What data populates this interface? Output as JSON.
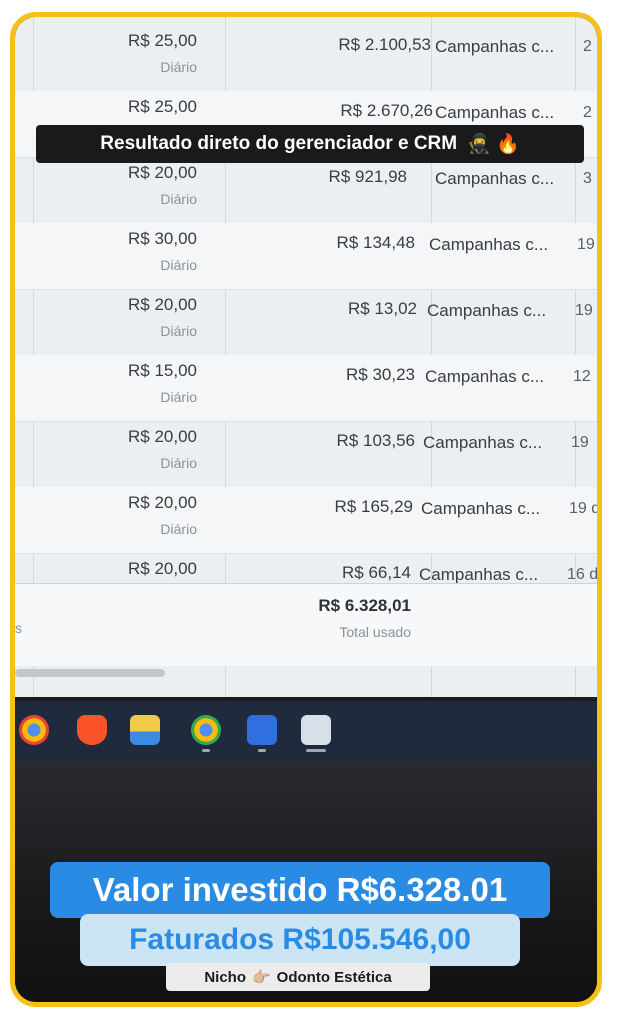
{
  "caption": "Resultado direto do gerenciador e CRM",
  "caption_emojis": "🥷 🔥",
  "table": {
    "rows": [
      {
        "budget": "R$ 25,00",
        "budget_type": "Diário",
        "spent": "R$ 2.100,53",
        "campaign": "Campanhas c...",
        "extra": "2"
      },
      {
        "budget": "R$ 25,00",
        "budget_type": "",
        "spent": "R$ 2.670,26",
        "campaign": "Campanhas c...",
        "extra": "2"
      },
      {
        "budget": "R$ 20,00",
        "budget_type": "Diário",
        "spent": "R$ 921,98",
        "campaign": "Campanhas c...",
        "extra": "3"
      },
      {
        "budget": "R$ 30,00",
        "budget_type": "Diário",
        "spent": "R$ 134,48",
        "campaign": "Campanhas c...",
        "extra": "19"
      },
      {
        "budget": "R$ 20,00",
        "budget_type": "Diário",
        "spent": "R$ 13,02",
        "campaign": "Campanhas c...",
        "extra": "19"
      },
      {
        "budget": "R$ 15,00",
        "budget_type": "Diário",
        "spent": "R$ 30,23",
        "campaign": "Campanhas c...",
        "extra": "12"
      },
      {
        "budget": "R$ 20,00",
        "budget_type": "Diário",
        "spent": "R$ 103,56",
        "campaign": "Campanhas c...",
        "extra": "19"
      },
      {
        "budget": "R$ 20,00",
        "budget_type": "Diário",
        "spent": "R$ 165,29",
        "campaign": "Campanhas c...",
        "extra": "19 d"
      },
      {
        "budget": "R$ 20,00",
        "budget_type": "",
        "spent": "R$ 66,14",
        "campaign": "Campanhas c...",
        "extra": "16 d"
      }
    ],
    "total_value": "R$ 6.328,01",
    "total_label": "Total usado",
    "total_left_fragment": "s"
  },
  "taskbar": {
    "icons": [
      "chrome-icon",
      "brave-icon",
      "file-explorer-icon",
      "chrome-canary-icon",
      "game-app-icon",
      "chrome-profile-icon"
    ]
  },
  "highlight_invested": "Valor investido R$6.328.01",
  "highlight_revenue": "Faturados R$105.546,00",
  "niche_label": "Nicho",
  "niche_emoji": "👉🏼",
  "niche_value": "Odonto Estética",
  "colors": {
    "frame": "#f5c018",
    "accent": "#2a8be5",
    "accent_light": "#cce5f4"
  }
}
